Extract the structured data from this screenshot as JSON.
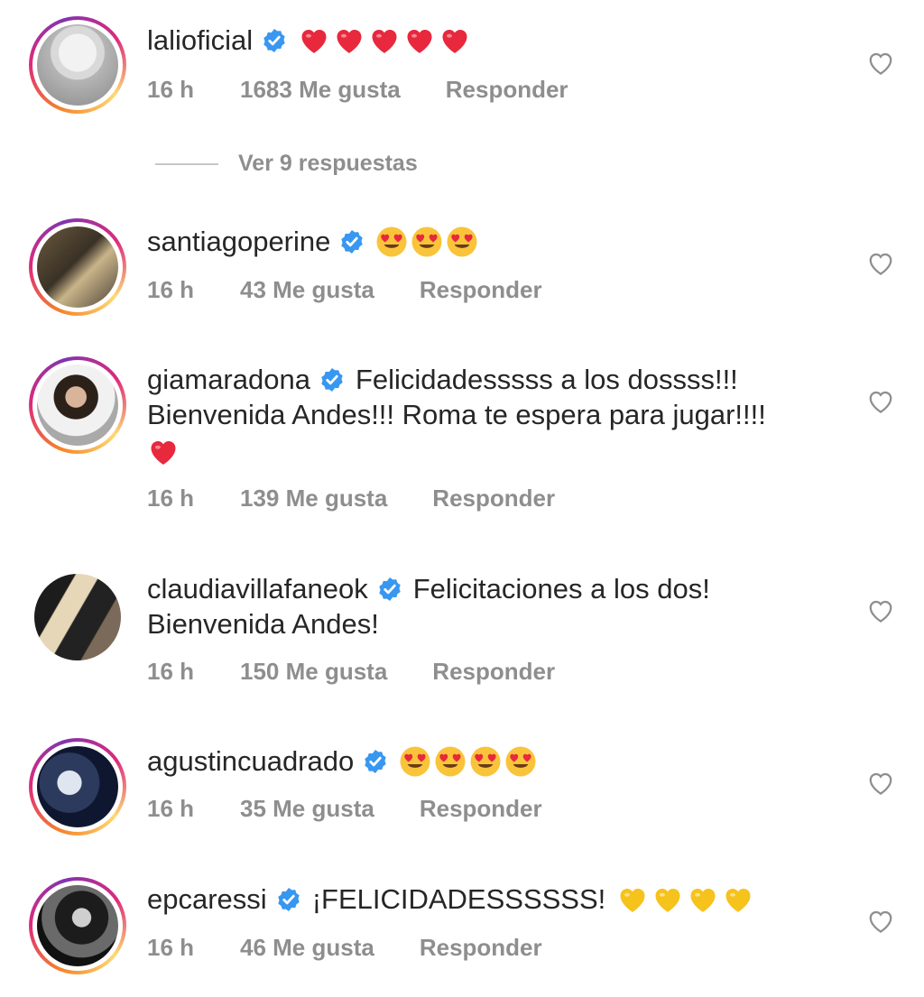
{
  "view_replies": "Ver 9 respuestas",
  "reply_label": "Responder",
  "comments": [
    {
      "username": "lalioficial",
      "verified": true,
      "text": "",
      "emojis": [
        "red-heart",
        "red-heart",
        "red-heart",
        "red-heart",
        "red-heart"
      ],
      "time": "16 h",
      "likes": "1683 Me gusta"
    },
    {
      "username": "santiagoperine",
      "verified": true,
      "text": "",
      "emojis": [
        "heart-eyes",
        "heart-eyes",
        "heart-eyes"
      ],
      "time": "16 h",
      "likes": "43 Me gusta"
    },
    {
      "username": "giamaradona",
      "verified": true,
      "text": "Felicidadesssss a los dossss!!!",
      "text2": "Bienvenida Andes!!! Roma te espera para jugar!!!!",
      "emojis3": [
        "red-heart"
      ],
      "time": "16 h",
      "likes": "139 Me gusta"
    },
    {
      "username": "claudiavillafaneok",
      "verified": true,
      "text": "Felicitaciones a los dos!",
      "text2": "Bienvenida Andes!",
      "time": "16 h",
      "likes": "150 Me gusta"
    },
    {
      "username": "agustincuadrado",
      "verified": true,
      "text": "",
      "emojis": [
        "heart-eyes",
        "heart-eyes",
        "heart-eyes",
        "heart-eyes"
      ],
      "time": "16 h",
      "likes": "35 Me gusta"
    },
    {
      "username": "epcaressi",
      "verified": true,
      "text": "¡FELICIDADESSSSSS!",
      "emojis": [
        "yellow-heart",
        "yellow-heart",
        "yellow-heart",
        "yellow-heart"
      ],
      "time": "16 h",
      "likes": "46 Me gusta"
    }
  ],
  "colors": {
    "text": "#262626",
    "meta": "#8e8e8e",
    "verified": "#3897f0",
    "red_heart": "#e8283d",
    "yellow_heart": "#f6c21c",
    "emoji_face": "#f9c43a"
  }
}
